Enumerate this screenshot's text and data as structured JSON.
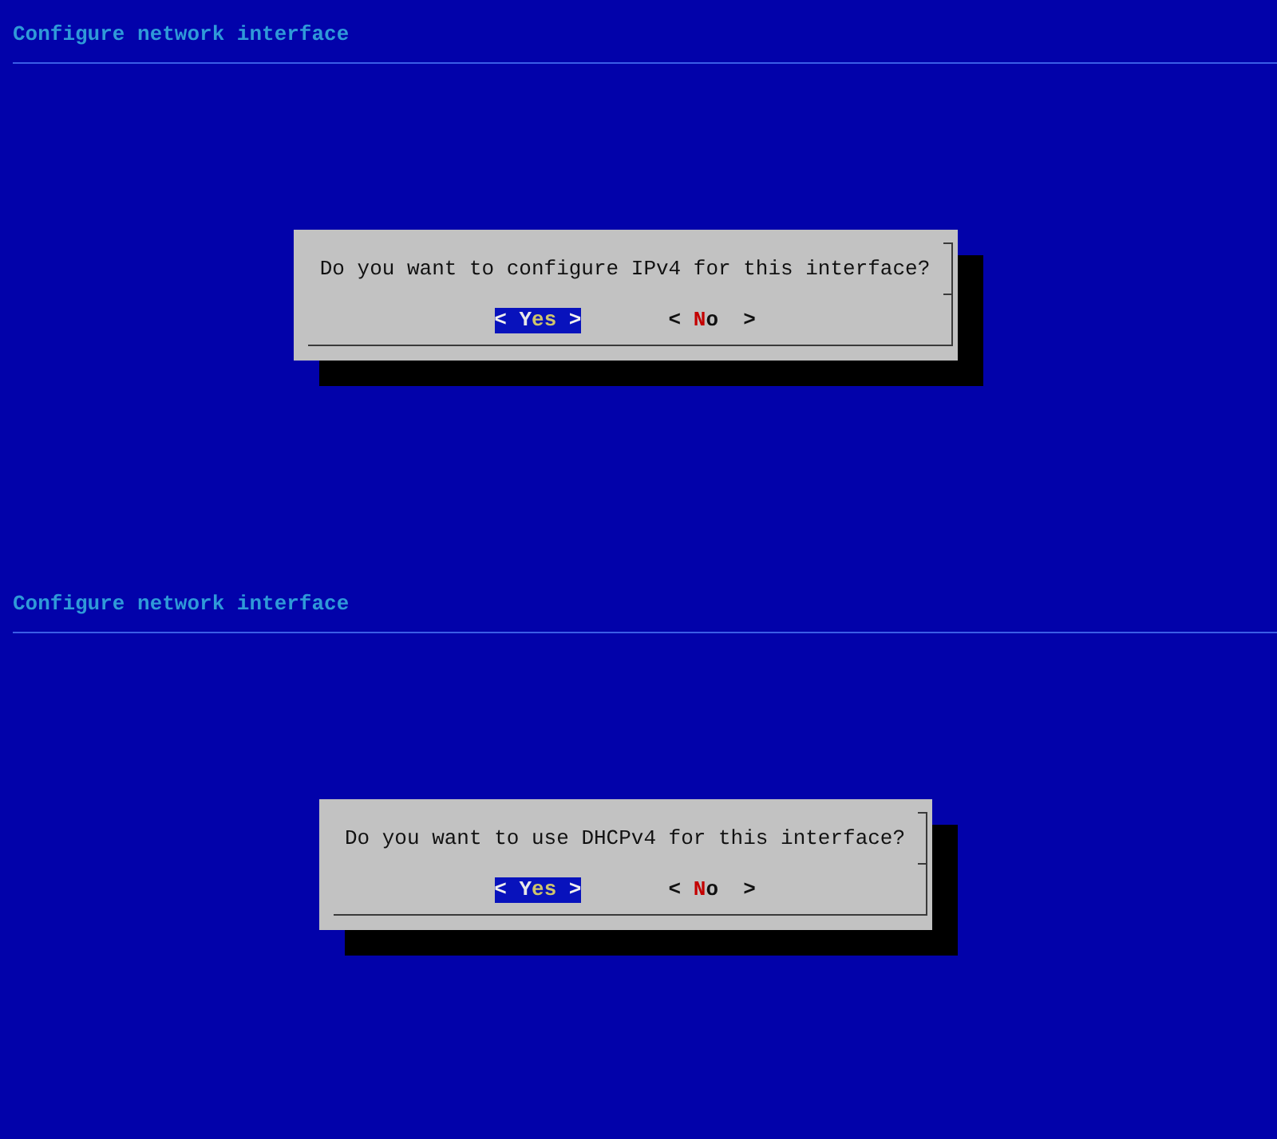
{
  "screens": [
    {
      "backtitle": "Configure network interface",
      "dialog": {
        "question": "Do you want to configure IPv4 for this interface?",
        "buttons": [
          {
            "open": "<",
            "label": "Yes",
            "close": ">",
            "selected": true
          },
          {
            "open": "<",
            "label": "No",
            "close": ">",
            "selected": false
          }
        ]
      }
    },
    {
      "backtitle": "Configure network interface",
      "dialog": {
        "question": "Do you want to use DHCPv4 for this interface?",
        "buttons": [
          {
            "open": "<",
            "label": "Yes",
            "close": ">",
            "selected": true
          },
          {
            "open": "<",
            "label": "No",
            "close": ">",
            "selected": false
          }
        ]
      }
    }
  ]
}
